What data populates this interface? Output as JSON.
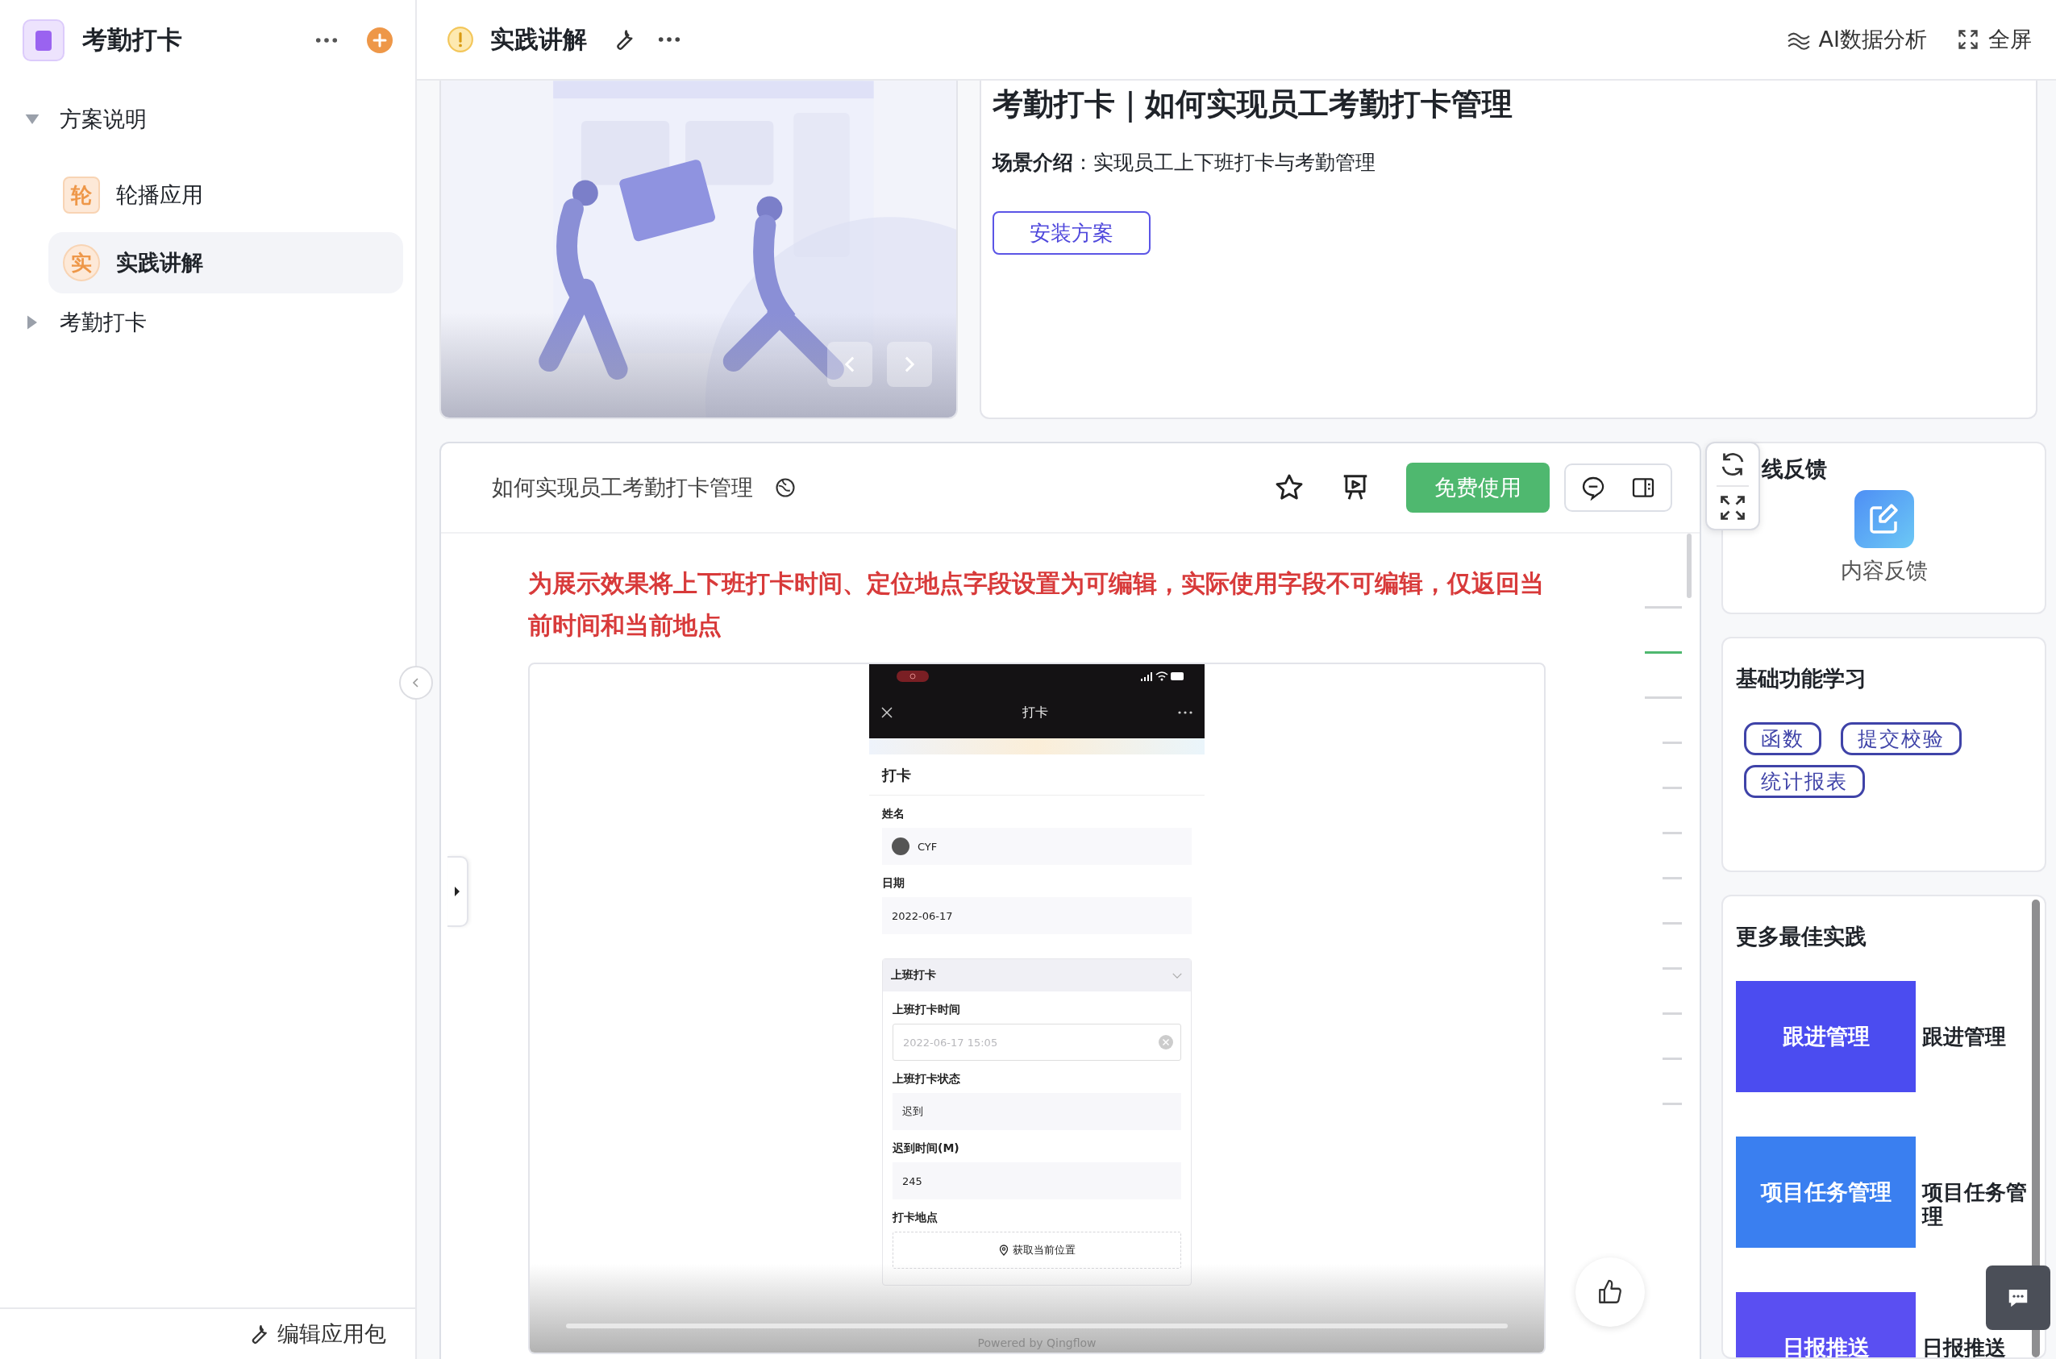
{
  "sidebar": {
    "app_title": "考勤打卡",
    "tree": [
      {
        "label": "方案说明",
        "expanded": true,
        "selected": false,
        "children": [
          {
            "label": "轮播应用",
            "badge": "轮",
            "kind": "square",
            "selected": false
          },
          {
            "label": "实践讲解",
            "badge": "实",
            "kind": "circle",
            "selected": true
          }
        ]
      },
      {
        "label": "考勤打卡",
        "expanded": false,
        "selected": false
      }
    ],
    "footer_button": "编辑应用包"
  },
  "topbar": {
    "title": "实践讲解",
    "actions": [
      {
        "label": "AI数据分析",
        "kind": "analysis"
      },
      {
        "label": "全屏",
        "kind": "fullscreen"
      }
    ]
  },
  "banner": {
    "title": "考勤打卡｜如何实现员工考勤打卡管理",
    "intro": "**场景介绍**：实现员工上下班打卡与考勤管理",
    "button": "安装方案"
  },
  "document": {
    "title": "如何实现员工考勤打卡管理",
    "use_button": "免费使用",
    "notice": "为展示效果将上下班打卡时间、定位地点字段设置为可编辑，实际使用字段不可编辑，仅返回当前时间和当前地点",
    "toc": [
      {
        "selected": false
      },
      {
        "selected": true
      },
      {
        "selected": false,
        "children": [
          {
            "selected": false
          },
          {
            "selected": false
          },
          {
            "selected": false
          },
          {
            "selected": false
          },
          {
            "selected": false
          },
          {
            "selected": false
          },
          {
            "selected": false
          },
          {
            "selected": false
          },
          {
            "selected": false
          }
        ]
      }
    ],
    "phone": {
      "nav_title": "打卡",
      "form_title": "打卡",
      "fields": [
        {
          "label": "姓名",
          "value": "CYF",
          "kind": "user"
        },
        {
          "label": "日期",
          "value": "2022-06-17",
          "kind": "text"
        }
      ],
      "section": {
        "title": "上班打卡",
        "expanded": true,
        "fields": [
          {
            "label": "上班打卡时间",
            "value": "2022-06-17 15:05",
            "kind": "datetime"
          },
          {
            "label": "上班打卡状态",
            "value": "迟到",
            "kind": "text"
          },
          {
            "label": "迟到时间(M)",
            "value": "245",
            "kind": "text"
          },
          {
            "label": "打卡地点",
            "value": "获取当前位置",
            "kind": "location"
          }
        ]
      },
      "footer": "Powered by Qingflow"
    }
  },
  "feedback": {
    "title": "线反馈",
    "button": "内容反馈"
  },
  "learning": {
    "title": "基础功能学习",
    "tags": [
      "函数",
      "提交校验",
      "统计报表"
    ]
  },
  "practices": {
    "title": "更多最佳实践",
    "items": [
      {
        "thumbnail": "跟进管理",
        "label": "跟进管理",
        "color": "#4b4cf0"
      },
      {
        "thumbnail": "项目任务管理",
        "label": "项目任务管理",
        "color": "#3a7ff0"
      },
      {
        "thumbnail": "日报推送",
        "label": "日报推送",
        "color": "#5a4ff2"
      }
    ]
  }
}
